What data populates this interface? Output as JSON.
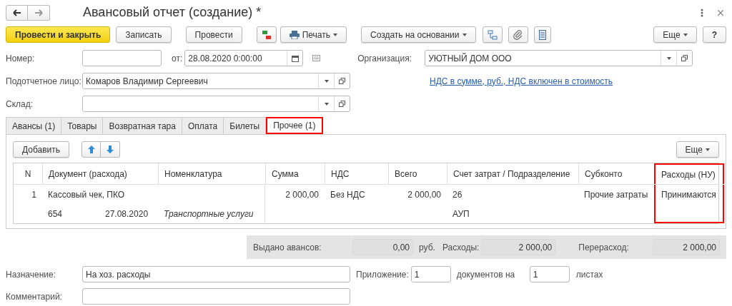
{
  "window": {
    "title": "Авансовый отчет (создание) *"
  },
  "toolbar": {
    "primary": "Провести и закрыть",
    "buttons": [
      "Записать",
      "Провести"
    ],
    "print": "Печать",
    "create_based": "Создать на основании",
    "more": "Еще",
    "help": "?"
  },
  "header": {
    "number_label": "Номер:",
    "date_label": "от:",
    "date_value": "28.08.2020  0:00:00",
    "organization_label": "Организация:",
    "organization_value": "УЮТНЫЙ ДОМ ООО",
    "person_label": "Подотчетное лицо:",
    "person_value": "Комаров Владимир Сергеевич",
    "vat_link": "НДС в сумме, руб., НДС включен в стоимость",
    "warehouse_label": "Склад:"
  },
  "tabs": [
    {
      "label": "Авансы (1)",
      "selected": false,
      "highlighted": false
    },
    {
      "label": "Товары",
      "selected": false,
      "highlighted": false
    },
    {
      "label": "Возвратная тара",
      "selected": false,
      "highlighted": false
    },
    {
      "label": "Оплата",
      "selected": false,
      "highlighted": false
    },
    {
      "label": "Билеты",
      "selected": false,
      "highlighted": false
    },
    {
      "label": "Прочее (1)",
      "selected": true,
      "highlighted": true
    }
  ],
  "table_toolbar": {
    "add": "Добавить",
    "more": "Еще"
  },
  "table": {
    "columns": [
      {
        "label": "N",
        "highlighted": false
      },
      {
        "label": "Документ (расхода)",
        "highlighted": false
      },
      {
        "label": "Номенклатура",
        "highlighted": false
      },
      {
        "label": "Сумма",
        "highlighted": false
      },
      {
        "label": "НДС",
        "highlighted": false
      },
      {
        "label": "Всего",
        "highlighted": false
      },
      {
        "label": "Счет затрат / Подразделение",
        "highlighted": false
      },
      {
        "label": "Субконто",
        "highlighted": false
      },
      {
        "label": "Расходы (НУ)",
        "highlighted": true
      }
    ],
    "rows": [
      {
        "n": "1",
        "document": "Кассовый чек, ПКО",
        "document_number": "654",
        "document_date": "27.08.2020",
        "nomenclature": "Транспортные услуги",
        "sum": "2 000,00",
        "vat": "Без НДС",
        "total": "2 000,00",
        "account": "26",
        "subdivision": "АУП",
        "subconto": "Прочие затраты",
        "expenses_nu": "Принимаются"
      }
    ]
  },
  "totals": {
    "issued_label": "Выдано авансов:",
    "issued_value": "0,00",
    "currency": "руб.",
    "expenses_label": "Расходы:",
    "expenses_value": "2 000,00",
    "overspend_label": "Перерасход:",
    "overspend_value": "2 000,00"
  },
  "footer": {
    "purpose_label": "Назначение:",
    "purpose_value": "На хоз. расходы",
    "attachment_label": "Приложение:",
    "attachment_value": "1",
    "documents_label": "документов на",
    "sheets_value": "1",
    "sheets_label": "листах",
    "comment_label": "Комментарий:"
  }
}
